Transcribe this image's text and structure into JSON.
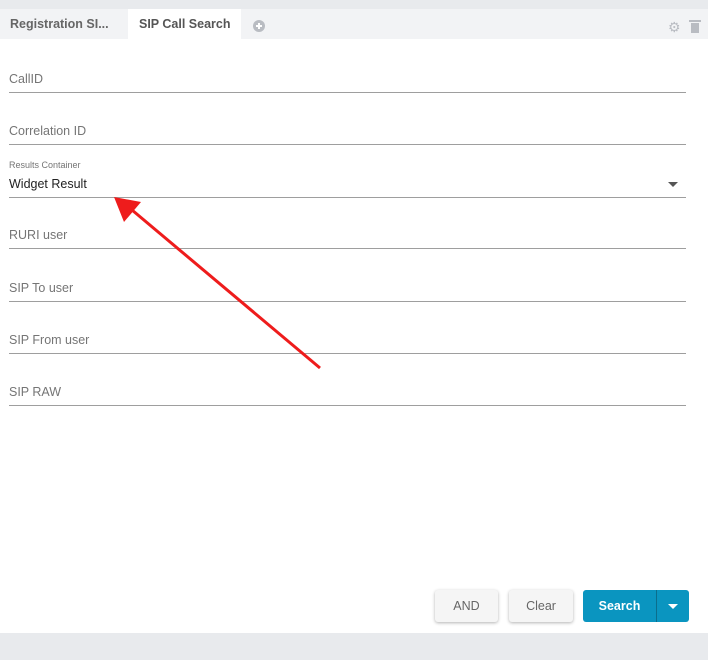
{
  "tabs": [
    {
      "label": "Registration SI..."
    },
    {
      "label": "SIP Call Search"
    }
  ],
  "form": {
    "callid_placeholder": "CallID",
    "correlation_placeholder": "Correlation ID",
    "results_container_label": "Results Container",
    "results_container_value": "Widget Result",
    "ruri_placeholder": "RURI user",
    "sip_to_placeholder": "SIP To user",
    "sip_from_placeholder": "SIP From user",
    "sip_raw_placeholder": "SIP RAW"
  },
  "buttons": {
    "and": "AND",
    "clear": "Clear",
    "search": "Search"
  },
  "colors": {
    "accent": "#0a95c0",
    "annotation_arrow": "#ee1c1c"
  },
  "icons": {
    "add_tab": "plus-circle-icon",
    "settings": "gear-icon",
    "delete": "trash-icon",
    "search_dropdown": "caret-down-icon"
  }
}
